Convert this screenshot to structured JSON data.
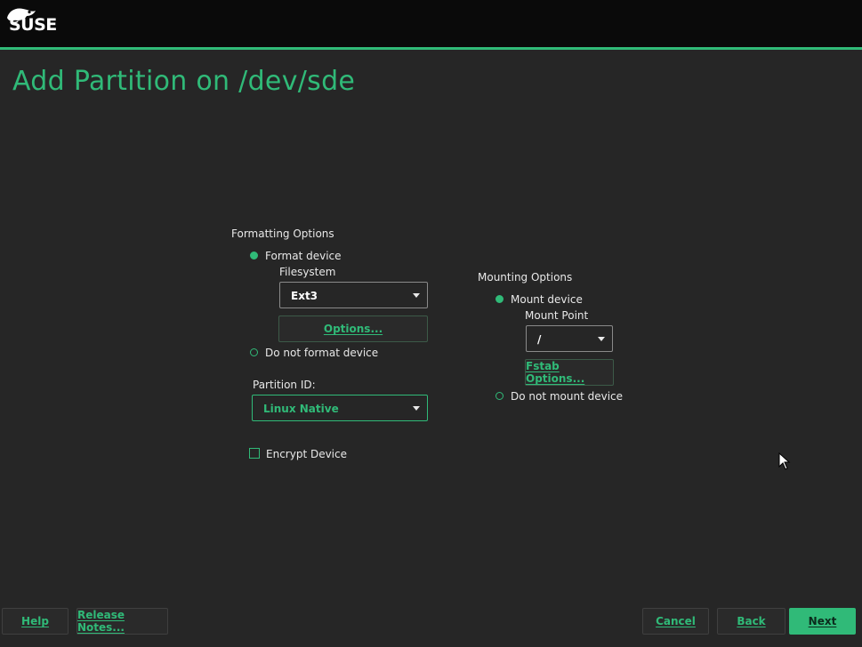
{
  "header": {
    "logo_text": "SUSE",
    "accent": "#30ba78"
  },
  "page_title": "Add Partition on /dev/sde",
  "formatting": {
    "section_label": "Formatting Options",
    "format_device_label": "Format device",
    "filesystem_label": "Filesystem",
    "filesystem_value": "Ext3",
    "options_button": "Options...",
    "no_format_label": "Do not format device",
    "partition_id_label": "Partition ID:",
    "partition_id_value": "Linux Native",
    "encrypt_label": "Encrypt Device"
  },
  "mounting": {
    "section_label": "Mounting Options",
    "mount_device_label": "Mount device",
    "mount_point_label": "Mount Point",
    "mount_point_value": "/",
    "fstab_button": "Fstab Options...",
    "no_mount_label": "Do not mount device"
  },
  "footer": {
    "help": "Help",
    "release_notes": "Release Notes...",
    "cancel": "Cancel",
    "back": "Back",
    "next": "Next"
  }
}
